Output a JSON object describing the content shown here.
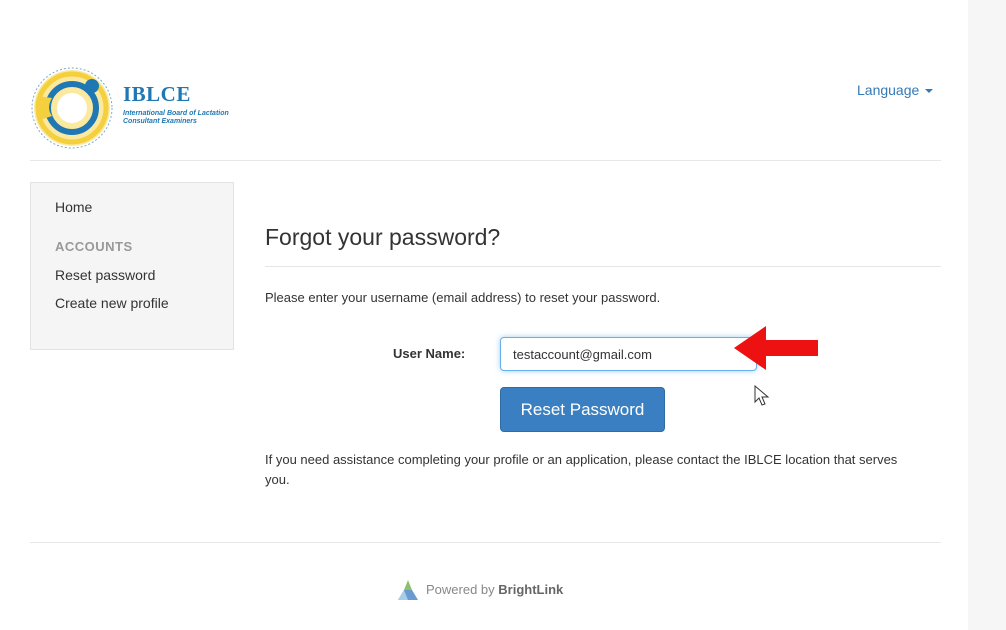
{
  "header": {
    "logo": {
      "title": "IBLCE",
      "subtitle": "International Board of Lactation Consultant Examiners"
    },
    "language_label": "Language"
  },
  "sidebar": {
    "home": "Home",
    "section_header": "ACCOUNTS",
    "items": [
      {
        "label": "Reset password"
      },
      {
        "label": "Create new profile"
      }
    ]
  },
  "main": {
    "title": "Forgot your password?",
    "instruction": "Please enter your username (email address) to reset your password.",
    "username_label": "User Name:",
    "username_value": "testaccount@gmail.com",
    "reset_button": "Reset Password",
    "help_text": "If you need assistance completing your profile or an application, please contact the IBLCE location that serves you."
  },
  "annotation": {
    "arrow_color": "#ee1111"
  },
  "footer": {
    "powered_by": "Powered by",
    "brand": "BrightLink"
  },
  "colors": {
    "link": "#337ab7",
    "button": "#3a7fc1",
    "logo_blue": "#1f78b4",
    "logo_yellow": "#f4d03f"
  }
}
